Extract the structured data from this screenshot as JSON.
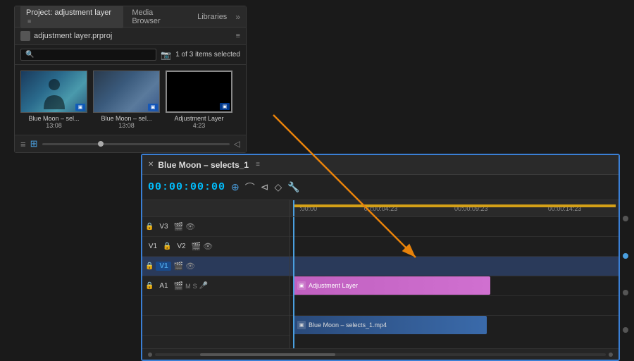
{
  "project_panel": {
    "tabs": [
      {
        "label": "Project: adjustment layer",
        "active": true,
        "icon": "≡"
      },
      {
        "label": "Media Browser",
        "active": false
      },
      {
        "label": "Libraries",
        "active": false
      }
    ],
    "more_label": "»",
    "header": {
      "title": "adjustment layer.prproj",
      "menu_icon": "≡"
    },
    "search": {
      "placeholder": "",
      "items_selected": "1 of 3 items selected"
    },
    "thumbnails": [
      {
        "label": "Blue Moon – sel...",
        "duration": "13:08",
        "type": "video1"
      },
      {
        "label": "Blue Moon – sel...",
        "duration": "13:08",
        "type": "video2"
      },
      {
        "label": "Adjustment Layer",
        "duration": "4:23",
        "type": "black",
        "selected": true
      }
    ]
  },
  "timeline_panel": {
    "title": "Blue Moon – selects_1",
    "menu_icon": "≡",
    "close_icon": "✕",
    "timecode": "00:00:00:00",
    "tools": [
      "ripple",
      "razor",
      "slip",
      "shape",
      "wrench"
    ],
    "ruler": {
      "marks": [
        {
          "label": ":00:00",
          "pos": "2%"
        },
        {
          "label": "00:00:04:23",
          "pos": "22%"
        },
        {
          "label": "00:00:09:23",
          "pos": "52%"
        },
        {
          "label": "00:00:14:23",
          "pos": "82%"
        }
      ]
    },
    "tracks": [
      {
        "name": "V3",
        "type": "video",
        "highlight": false
      },
      {
        "name": "V2",
        "type": "video",
        "highlight": false
      },
      {
        "name": "V1",
        "type": "video",
        "highlight": true
      },
      {
        "name": "A1",
        "type": "audio",
        "highlight": false
      }
    ],
    "clips": [
      {
        "label": "Adjustment Layer",
        "type": "adjustment"
      },
      {
        "label": "Blue Moon – selects_1.mp4",
        "type": "video"
      }
    ],
    "right_dots": [
      {
        "active": false
      },
      {
        "active": true
      },
      {
        "active": false
      },
      {
        "active": false
      }
    ]
  }
}
